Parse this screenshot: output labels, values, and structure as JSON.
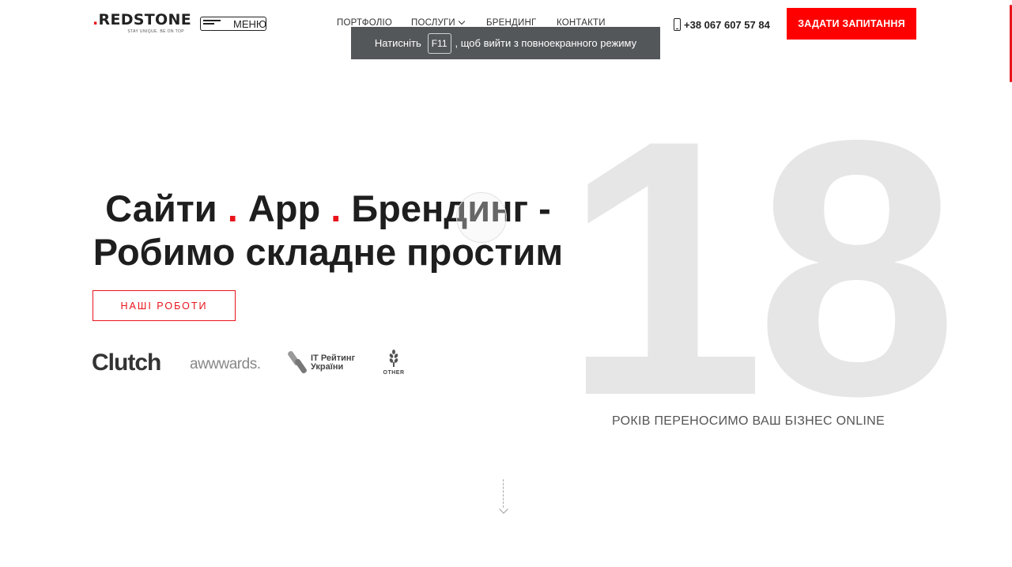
{
  "header": {
    "logo_text": "REDSTONE",
    "logo_tagline": "STAY UNIQUE. BE ON TOP",
    "menu_label": "МЕНЮ",
    "nav": {
      "portfolio": "ПОРТФОЛІО",
      "services": "ПОСЛУГИ",
      "branding": "БРЕНДИНГ",
      "contacts": "КОНТАКТИ"
    },
    "phone": "+38 067 607 57 84",
    "cta_label": "ЗАДАТИ ЗАПИТАННЯ"
  },
  "toast": {
    "before": "Натисніть",
    "key": "F11",
    "after": ", щоб вийти з повноекранного режиму"
  },
  "hero": {
    "word_sites": "Сайти",
    "word_app": "App",
    "word_branding": "Брендинг -",
    "dot": ".",
    "line2": "Робимо складне простим",
    "works_button": "НАШІ РОБОТИ",
    "big_number": "18",
    "years_caption": "РОКІВ ПЕРЕНОСИМО ВАШ БІЗНЕС ONLINE"
  },
  "awards": {
    "clutch": "Clutch",
    "awwwards": "awwwards.",
    "it_rating_line1": "IT Рейтинг",
    "it_rating_line2": "України",
    "other": "OTHER"
  },
  "colors": {
    "accent": "#ff0000",
    "big_number": "#e6e6e6",
    "toast_bg": "#54575a"
  }
}
